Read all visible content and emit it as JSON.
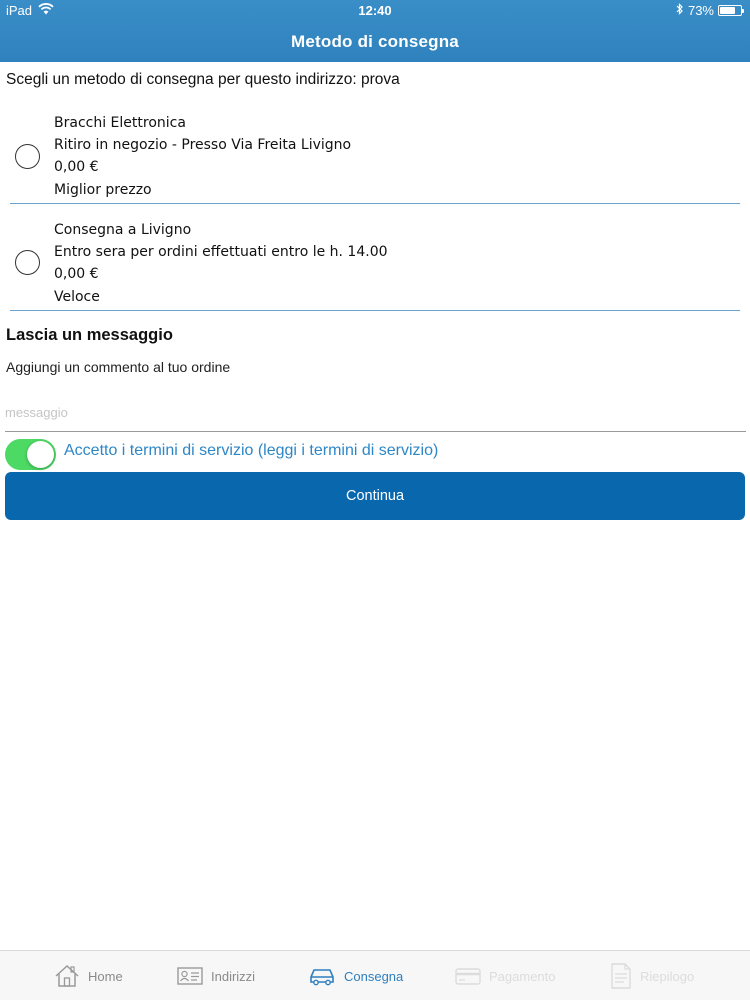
{
  "status_bar": {
    "device": "iPad",
    "time": "12:40",
    "battery": "73%",
    "battery_level": 0.73,
    "icons": [
      "wifi-icon",
      "bluetooth-icon",
      "battery-icon"
    ]
  },
  "nav": {
    "title": "Metodo di consegna"
  },
  "intro": "Scegli un metodo di consegna per questo indirizzo: prova",
  "shipping_options": [
    {
      "name": "Bracchi Elettronica",
      "description": "Ritiro in negozio - Presso Via Freita Livigno",
      "price": "0,00 €",
      "tag": "Miglior prezzo",
      "selected": false
    },
    {
      "name": "Consegna a Livigno",
      "description": "Entro sera per ordini effettuati entro le h. 14.00",
      "price": "0,00 €",
      "tag": "Veloce",
      "selected": false
    }
  ],
  "message": {
    "title": "Lascia un messaggio",
    "subtitle": "Aggiungi un commento al tuo ordine",
    "placeholder": "messaggio",
    "value": ""
  },
  "terms": {
    "label": "Accetto i termini di servizio (leggi i termini di servizio)",
    "accepted": true
  },
  "continue_label": "Continua",
  "colors": {
    "header": "#3489c4",
    "primary_button": "#0867ad",
    "toggle_on": "#4cd964",
    "link": "#2d87c7",
    "tab_active": "#2f7fbf"
  },
  "tabbar": {
    "tabs": [
      {
        "label": "Home",
        "icon": "home-icon",
        "state": "normal"
      },
      {
        "label": "Indirizzi",
        "icon": "address-card-icon",
        "state": "normal"
      },
      {
        "label": "Consegna",
        "icon": "car-icon",
        "state": "active"
      },
      {
        "label": "Pagamento",
        "icon": "credit-card-icon",
        "state": "disabled"
      },
      {
        "label": "Riepilogo",
        "icon": "document-icon",
        "state": "disabled"
      }
    ]
  }
}
